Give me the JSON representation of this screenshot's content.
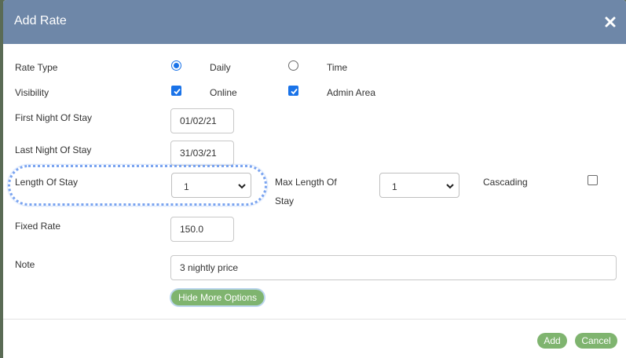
{
  "dialog": {
    "title": "Add Rate",
    "close_icon": "close-icon"
  },
  "form": {
    "rate_type": {
      "label": "Rate Type",
      "options": [
        {
          "label": "Daily",
          "selected": true
        },
        {
          "label": "Time",
          "selected": false
        }
      ]
    },
    "visibility": {
      "label": "Visibility",
      "options": [
        {
          "label": "Online",
          "checked": true
        },
        {
          "label": "Admin Area",
          "checked": true
        }
      ]
    },
    "first_night": {
      "label": "First Night Of Stay",
      "value": "01/02/21"
    },
    "last_night": {
      "label": "Last Night Of Stay",
      "value": "31/03/21"
    },
    "length_of_stay": {
      "label": "Length Of Stay",
      "value": "1"
    },
    "max_length_of_stay": {
      "label_line1": "Max Length Of",
      "label_line2": "Stay",
      "value": "1"
    },
    "cascading": {
      "label": "Cascading",
      "checked": false
    },
    "fixed_rate": {
      "label": "Fixed Rate",
      "value": "150.0"
    },
    "note": {
      "label": "Note",
      "value": "3 nightly price"
    },
    "more_options_label": "Hide More Options"
  },
  "footer": {
    "add_label": "Add",
    "cancel_label": "Cancel"
  },
  "colors": {
    "header": "#6e87a8",
    "button": "#7fb46f",
    "accent": "#1a73e8",
    "highlight": "#7aa4f0"
  }
}
